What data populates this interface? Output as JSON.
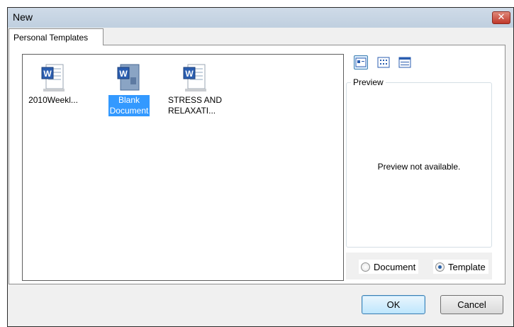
{
  "window": {
    "title": "New",
    "close_symbol": "✕"
  },
  "tabs": [
    {
      "label": "Personal Templates"
    }
  ],
  "templates": [
    {
      "label": "2010Weekl...",
      "icon": "word-document-icon",
      "selected": false
    },
    {
      "label": "Blank Document",
      "label_lines": [
        "Blank",
        "Document"
      ],
      "icon": "word-blank-document-icon",
      "selected": true
    },
    {
      "label": "STRESS AND RELAXATI...",
      "label_lines": [
        "STRESS AND",
        "RELAXATI..."
      ],
      "icon": "word-document-icon",
      "selected": false
    }
  ],
  "view_buttons": [
    {
      "icon": "large-icons-view-icon",
      "active": true
    },
    {
      "icon": "list-view-icon",
      "active": false
    },
    {
      "icon": "details-view-icon",
      "active": false
    }
  ],
  "preview": {
    "legend": "Preview",
    "message": "Preview not available."
  },
  "create_new": {
    "options": [
      {
        "label": "Document",
        "checked": false
      },
      {
        "label": "Template",
        "checked": true
      }
    ]
  },
  "buttons": {
    "ok": "OK",
    "cancel": "Cancel"
  },
  "colors": {
    "selection": "#3399ff",
    "titlebar": "#bfcfdf",
    "close": "#c0392b"
  }
}
